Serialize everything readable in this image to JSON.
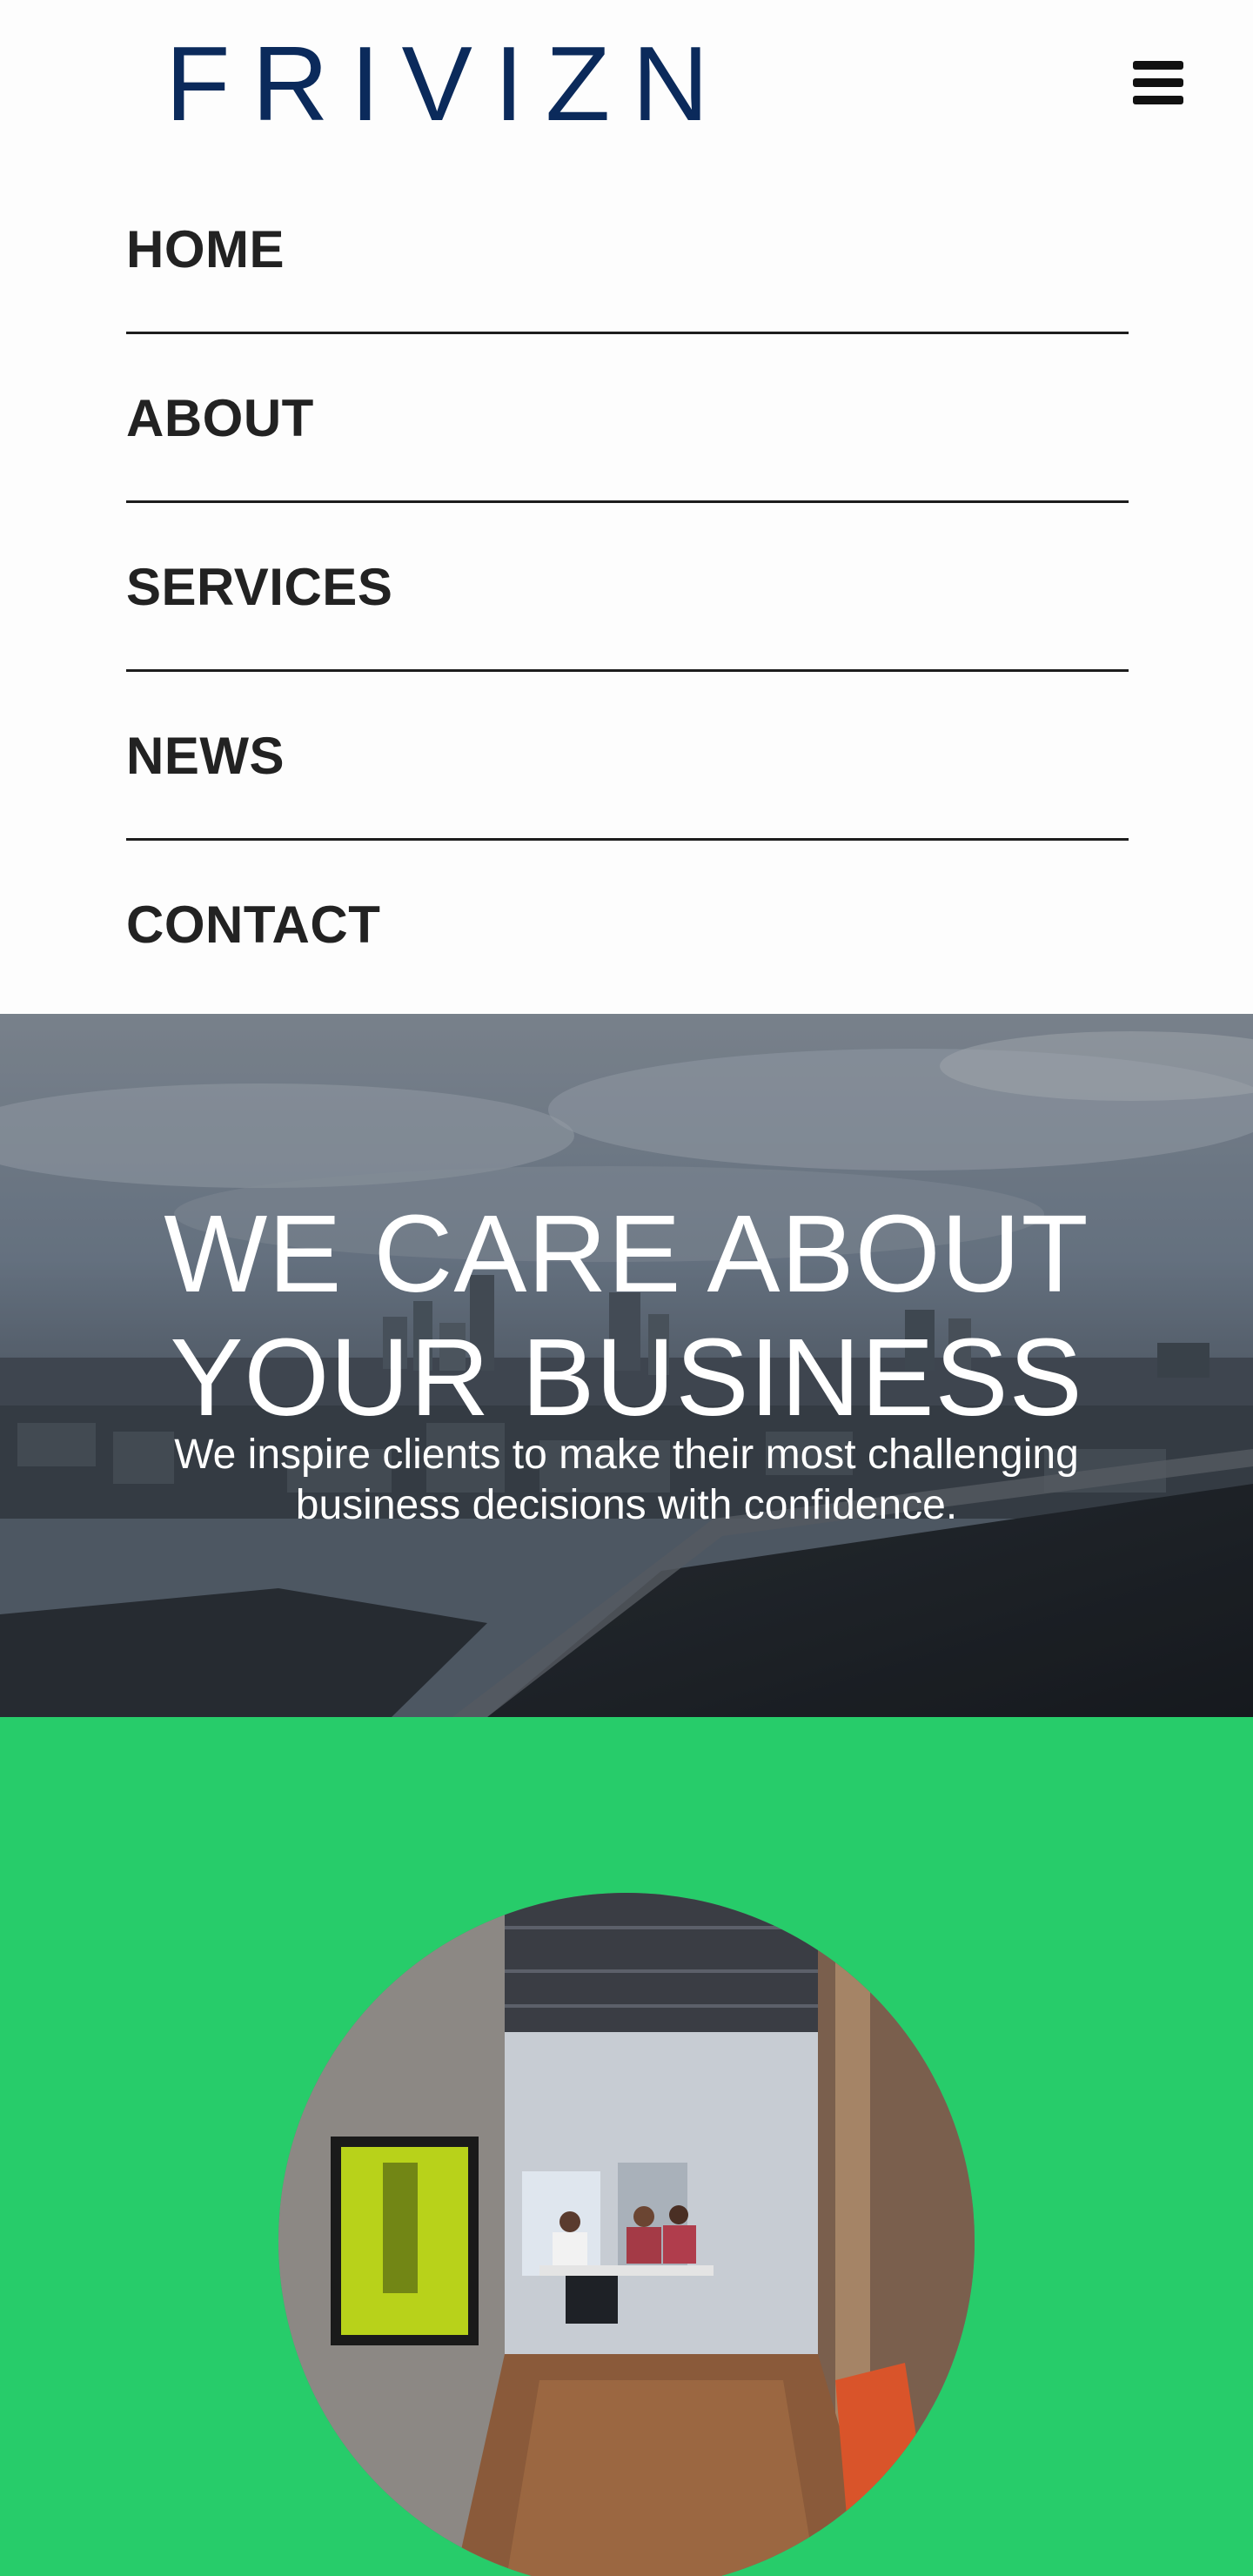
{
  "brand": {
    "logo_text": "FRIVIZN",
    "logo_color": "#0b2a5b"
  },
  "header": {
    "menu_icon": "hamburger-menu-icon"
  },
  "nav": {
    "items": [
      {
        "label": "HOME"
      },
      {
        "label": "ABOUT"
      },
      {
        "label": "SERVICES"
      },
      {
        "label": "NEWS"
      },
      {
        "label": "CONTACT"
      }
    ]
  },
  "hero": {
    "title_line1": "WE CARE ABOUT",
    "title_line2": "YOUR BUSINESS",
    "subtitle_line1": "We inspire clients to make their most challenging",
    "subtitle_line2": "business decisions with confidence."
  },
  "feature": {
    "background_color": "#27cc6a"
  }
}
